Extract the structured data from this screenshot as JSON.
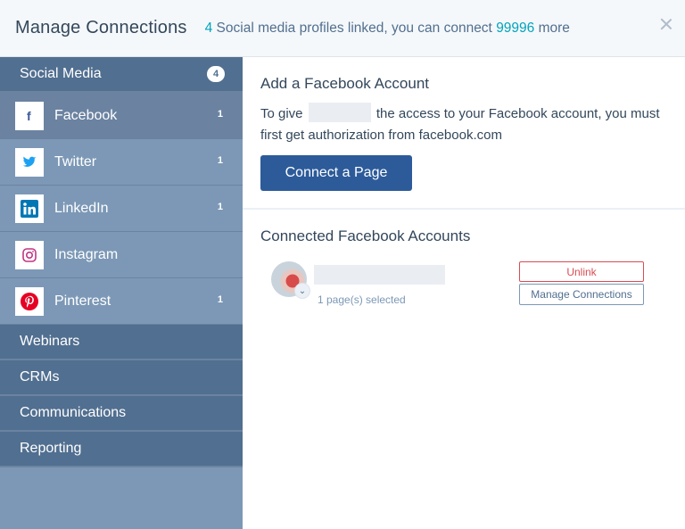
{
  "header": {
    "title": "Manage Connections",
    "linked_count": "4",
    "linked_text": " Social media profiles linked, you can connect ",
    "remaining_count": "99996",
    "remaining_text": " more"
  },
  "sidebar": {
    "social_media": {
      "label": "Social Media",
      "badge": "4"
    },
    "networks": [
      {
        "label": "Facebook",
        "count": "1",
        "icon": "facebook-icon",
        "color": "#3b5998"
      },
      {
        "label": "Twitter",
        "count": "1",
        "icon": "twitter-icon",
        "color": "#1da1f2"
      },
      {
        "label": "LinkedIn",
        "count": "1",
        "icon": "linkedin-icon",
        "color": "#0077b5"
      },
      {
        "label": "Instagram",
        "count": "",
        "icon": "instagram-icon",
        "color": "#c13584"
      },
      {
        "label": "Pinterest",
        "count": "1",
        "icon": "pinterest-icon",
        "color": "#e60023"
      }
    ],
    "sections": [
      "Webinars",
      "CRMs",
      "Communications",
      "Reporting"
    ]
  },
  "main": {
    "add_title": "Add a Facebook Account",
    "desc_before": "To give ",
    "desc_after": " the access to your Facebook account, you must first get authorization from facebook.com",
    "connect_button": "Connect a Page",
    "connected_title": "Connected Facebook Accounts",
    "account": {
      "pages_selected": "1 page(s) selected",
      "unlink_label": "Unlink",
      "manage_label": "Manage Connections"
    }
  },
  "colors": {
    "accent": "#00a4bd",
    "primary_button": "#2d5b9a",
    "danger": "#d94c53",
    "sidebar": "#7c98b6",
    "sidebar_dark": "#516f90"
  }
}
